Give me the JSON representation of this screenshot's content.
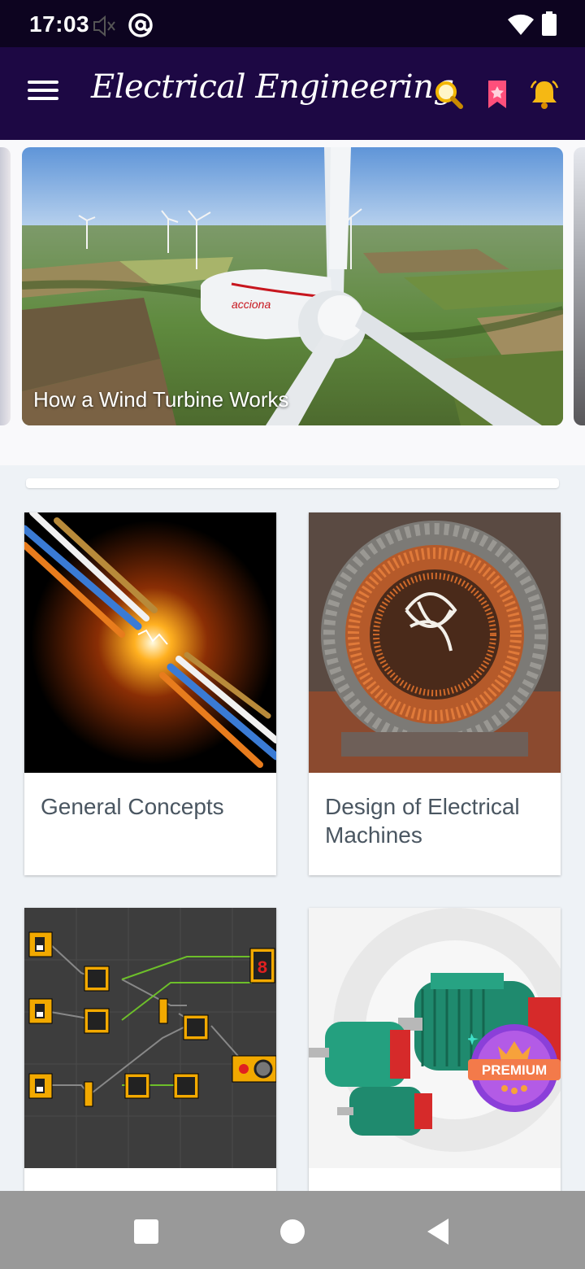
{
  "status_bar": {
    "time": "17:03",
    "icons": [
      "volume-off-icon",
      "at-icon",
      "wifi-icon",
      "battery-icon"
    ]
  },
  "app_bar": {
    "title": "Electrical Engineering",
    "icons": [
      "menu-icon",
      "search-icon",
      "bookmark-icon",
      "bell-icon"
    ],
    "accent": "#f5c518",
    "background": "#1d0844"
  },
  "carousel": {
    "slides": [
      {
        "caption": "How a Wind Turbine Works"
      }
    ]
  },
  "categories": [
    {
      "label": "General Concepts"
    },
    {
      "label": "Design of Electrical Machines"
    },
    {
      "label": ""
    },
    {
      "label": "",
      "badge": "PREMIUM"
    }
  ],
  "nav_bar": {
    "icons": [
      "recents-square-icon",
      "home-circle-icon",
      "back-triangle-icon"
    ]
  }
}
